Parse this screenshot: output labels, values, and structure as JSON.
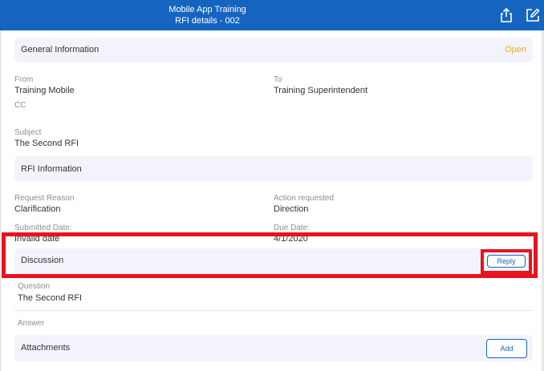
{
  "header": {
    "title": "Mobile App Training",
    "subtitle": "RFI details - 002",
    "share_icon": "share-icon",
    "edit_icon": "edit-icon"
  },
  "general": {
    "section_label": "General Information",
    "status": "Open",
    "from_label": "From",
    "from_value": "Training Mobile",
    "to_label": "To",
    "to_value": "Training Superintendent",
    "cc_label": "CC",
    "subject_label": "Subject",
    "subject_value": "The Second RFI"
  },
  "rfi": {
    "section_label": "RFI Information",
    "reason_label": "Request Reason",
    "reason_value": "Clarification",
    "action_label": "Action requested",
    "action_value": "Direction",
    "submitted_label": "Submitted Date:",
    "submitted_value": "Invalid date",
    "due_label": "Due Date:",
    "due_value": "4/1/2020"
  },
  "discussion": {
    "section_label": "Discussion",
    "reply_label": "Reply",
    "question_label": "Question",
    "question_value": "The Second RFI",
    "answer_label": "Answer"
  },
  "attachments": {
    "section_label": "Attachments",
    "add_label": "Add"
  },
  "colors": {
    "header": "#1565c0",
    "status": "#f5a623",
    "highlight": "#e8131f"
  }
}
